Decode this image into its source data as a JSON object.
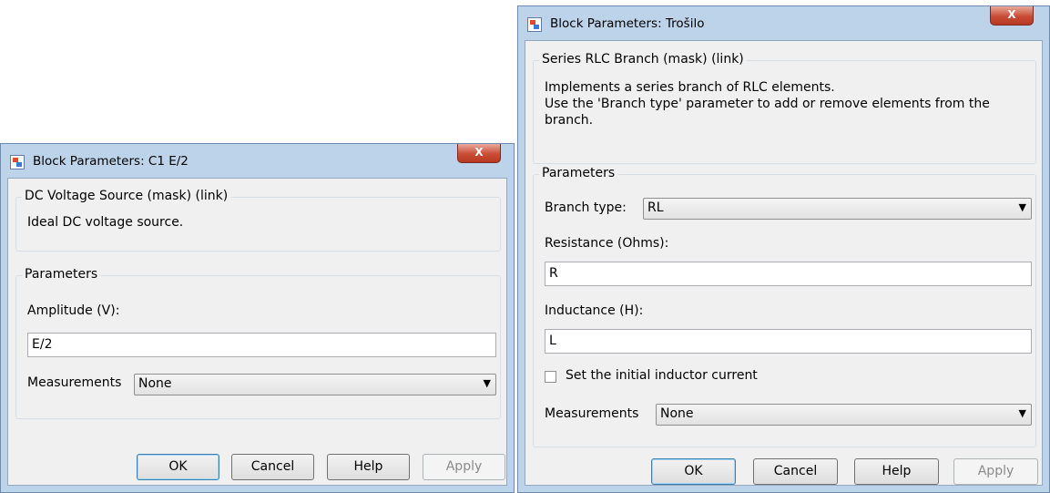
{
  "dialog_left": {
    "title": "Block Parameters: C1 E/2",
    "close_label": "X",
    "mask_group_label": "DC Voltage Source (mask) (link)",
    "description": "Ideal DC voltage source.",
    "params_group_label": "Parameters",
    "amplitude_label": "Amplitude (V):",
    "amplitude_value": "E/2",
    "measurements_label": "Measurements",
    "measurements_value": "None",
    "buttons": {
      "ok": "OK",
      "cancel": "Cancel",
      "help": "Help",
      "apply": "Apply"
    }
  },
  "dialog_right": {
    "title": "Block Parameters: Trošilo",
    "close_label": "X",
    "mask_group_label": "Series RLC Branch (mask) (link)",
    "description_lines": [
      "Implements a series branch of RLC elements.",
      "Use the 'Branch type' parameter to add or remove elements from the",
      "branch."
    ],
    "params_group_label": "Parameters",
    "branch_type_label": "Branch type:",
    "branch_type_value": "RL",
    "resistance_label": "Resistance (Ohms):",
    "resistance_value": "R",
    "inductance_label": "Inductance (H):",
    "inductance_value": "L",
    "initial_current_label": "Set the initial inductor current",
    "initial_current_checked": false,
    "measurements_label": "Measurements",
    "measurements_value": "None",
    "buttons": {
      "ok": "OK",
      "cancel": "Cancel",
      "help": "Help",
      "apply": "Apply"
    }
  },
  "icons": {
    "title_icon": "simulink-block-icon",
    "dropdown_arrow": "▼"
  }
}
